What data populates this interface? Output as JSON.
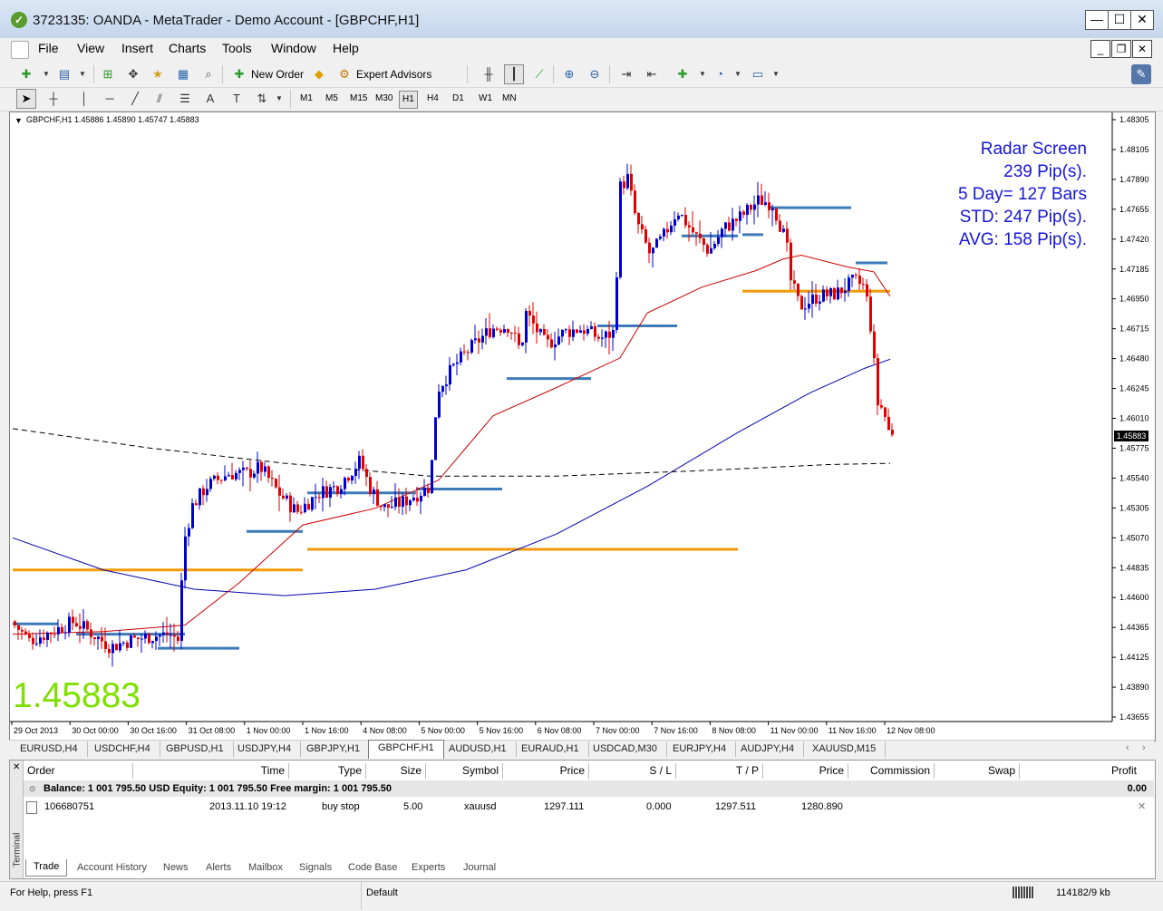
{
  "window": {
    "title": "3723135: OANDA - MetaTrader - Demo Account - [GBPCHF,H1]"
  },
  "menu": [
    "File",
    "View",
    "Insert",
    "Charts",
    "Tools",
    "Window",
    "Help"
  ],
  "toolbar": {
    "new_order": "New Order",
    "expert_advisors": "Expert Advisors",
    "timeframes": [
      "M1",
      "M5",
      "M15",
      "M30",
      "H1",
      "H4",
      "D1",
      "W1",
      "MN"
    ],
    "active_timeframe": "H1"
  },
  "chart": {
    "header": "GBPCHF,H1  1.45886 1.45890 1.45747 1.45883",
    "radar": [
      "Radar Screen",
      "239 Pip(s).",
      "5 Day= 127 Bars",
      "STD: 247 Pip(s).",
      "AVG: 158 Pip(s)."
    ],
    "big_price": "1.45883",
    "price_tag": "1.45883",
    "y_ticks": [
      "1.48305",
      "1.48105",
      "1.47890",
      "1.47655",
      "1.47420",
      "1.47185",
      "1.46950",
      "1.46715",
      "1.46480",
      "1.46245",
      "1.46010",
      "1.45775",
      "1.45540",
      "1.45305",
      "1.45070",
      "1.44835",
      "1.44600",
      "1.44365",
      "1.44125",
      "1.43890",
      "1.43655"
    ],
    "x_ticks": [
      "29 Oct 2013",
      "30 Oct 00:00",
      "30 Oct 16:00",
      "31 Oct 08:00",
      "1 Nov 00:00",
      "1 Nov 16:00",
      "4 Nov 08:00",
      "5 Nov 00:00",
      "5 Nov 16:00",
      "6 Nov 08:00",
      "7 Nov 00:00",
      "7 Nov 16:00",
      "8 Nov 08:00",
      "11 Nov 00:00",
      "11 Nov 16:00",
      "12 Nov 08:00"
    ],
    "colors": {
      "bull": "#0000cc",
      "bear": "#e00000",
      "ma_fast": "#cc0000",
      "ma_slow": "#0000aa",
      "level_blue": "#3d7ab8",
      "level_orange": "#f39a0b",
      "radar_text": "#1515d8",
      "big_price": "#7fe000"
    }
  },
  "chart_data": {
    "type": "candlestick",
    "ylim": [
      1.43655,
      1.48305
    ],
    "anchors": [
      {
        "x": 0,
        "y": 1.444
      },
      {
        "x": 20,
        "y": 1.4425
      },
      {
        "x": 45,
        "y": 1.4432
      },
      {
        "x": 70,
        "y": 1.444
      },
      {
        "x": 90,
        "y": 1.443
      },
      {
        "x": 110,
        "y": 1.442
      },
      {
        "x": 130,
        "y": 1.4425
      },
      {
        "x": 150,
        "y": 1.4428
      },
      {
        "x": 175,
        "y": 1.443
      },
      {
        "x": 185,
        "y": 1.4425
      },
      {
        "x": 190,
        "y": 1.45
      },
      {
        "x": 200,
        "y": 1.453
      },
      {
        "x": 215,
        "y": 1.4545
      },
      {
        "x": 240,
        "y": 1.4555
      },
      {
        "x": 260,
        "y": 1.4555
      },
      {
        "x": 275,
        "y": 1.456
      },
      {
        "x": 295,
        "y": 1.454
      },
      {
        "x": 315,
        "y": 1.4525
      },
      {
        "x": 340,
        "y": 1.454
      },
      {
        "x": 360,
        "y": 1.4545
      },
      {
        "x": 385,
        "y": 1.4565
      },
      {
        "x": 395,
        "y": 1.4545
      },
      {
        "x": 410,
        "y": 1.4528
      },
      {
        "x": 430,
        "y": 1.4532
      },
      {
        "x": 450,
        "y": 1.454
      },
      {
        "x": 462,
        "y": 1.4545
      },
      {
        "x": 470,
        "y": 1.462
      },
      {
        "x": 490,
        "y": 1.464
      },
      {
        "x": 510,
        "y": 1.4655
      },
      {
        "x": 530,
        "y": 1.4668
      },
      {
        "x": 550,
        "y": 1.467
      },
      {
        "x": 562,
        "y": 1.465
      },
      {
        "x": 568,
        "y": 1.468
      },
      {
        "x": 590,
        "y": 1.4655
      },
      {
        "x": 610,
        "y": 1.4665
      },
      {
        "x": 630,
        "y": 1.4668
      },
      {
        "x": 650,
        "y": 1.466
      },
      {
        "x": 665,
        "y": 1.4665
      },
      {
        "x": 672,
        "y": 1.4778
      },
      {
        "x": 680,
        "y": 1.4785
      },
      {
        "x": 690,
        "y": 1.475
      },
      {
        "x": 705,
        "y": 1.4725
      },
      {
        "x": 720,
        "y": 1.474
      },
      {
        "x": 735,
        "y": 1.476
      },
      {
        "x": 755,
        "y": 1.474
      },
      {
        "x": 770,
        "y": 1.4728
      },
      {
        "x": 785,
        "y": 1.4745
      },
      {
        "x": 805,
        "y": 1.4755
      },
      {
        "x": 825,
        "y": 1.4768
      },
      {
        "x": 840,
        "y": 1.4765
      },
      {
        "x": 855,
        "y": 1.4735
      },
      {
        "x": 860,
        "y": 1.4705
      },
      {
        "x": 870,
        "y": 1.4685
      },
      {
        "x": 890,
        "y": 1.4693
      },
      {
        "x": 910,
        "y": 1.4695
      },
      {
        "x": 930,
        "y": 1.4705
      },
      {
        "x": 942,
        "y": 1.47
      },
      {
        "x": 950,
        "y": 1.466
      },
      {
        "x": 955,
        "y": 1.461
      },
      {
        "x": 962,
        "y": 1.4605
      },
      {
        "x": 968,
        "y": 1.4588
      }
    ],
    "ma_fast": [
      [
        0,
        1.443
      ],
      [
        100,
        1.4432
      ],
      [
        190,
        1.4437
      ],
      [
        250,
        1.447
      ],
      [
        320,
        1.4515
      ],
      [
        400,
        1.4528
      ],
      [
        470,
        1.455
      ],
      [
        530,
        1.46
      ],
      [
        600,
        1.4622
      ],
      [
        670,
        1.4645
      ],
      [
        700,
        1.468
      ],
      [
        760,
        1.47
      ],
      [
        820,
        1.4713
      ],
      [
        850,
        1.4722
      ],
      [
        870,
        1.4725
      ],
      [
        920,
        1.4716
      ],
      [
        950,
        1.4712
      ],
      [
        968,
        1.4693
      ]
    ],
    "ma_slow": [
      [
        0,
        1.4505
      ],
      [
        100,
        1.448
      ],
      [
        200,
        1.4465
      ],
      [
        300,
        1.446
      ],
      [
        400,
        1.4465
      ],
      [
        500,
        1.448
      ],
      [
        600,
        1.4508
      ],
      [
        700,
        1.4545
      ],
      [
        800,
        1.4587
      ],
      [
        880,
        1.4618
      ],
      [
        940,
        1.4637
      ],
      [
        968,
        1.4644
      ]
    ],
    "ma_dashed": [
      [
        0,
        1.459
      ],
      [
        150,
        1.4575
      ],
      [
        300,
        1.4563
      ],
      [
        460,
        1.4553
      ],
      [
        600,
        1.4553
      ],
      [
        750,
        1.4557
      ],
      [
        900,
        1.4562
      ],
      [
        968,
        1.4563
      ]
    ],
    "levels": [
      {
        "color": "blue",
        "x1": 0,
        "x2": 50,
        "y": 1.4438
      },
      {
        "color": "blue",
        "x1": 70,
        "x2": 190,
        "y": 1.443
      },
      {
        "color": "blue",
        "x1": 160,
        "x2": 250,
        "y": 1.4419
      },
      {
        "color": "blue",
        "x1": 258,
        "x2": 320,
        "y": 1.451
      },
      {
        "color": "blue",
        "x1": 325,
        "x2": 445,
        "y": 1.454
      },
      {
        "color": "blue",
        "x1": 445,
        "x2": 540,
        "y": 1.4543
      },
      {
        "color": "blue",
        "x1": 545,
        "x2": 638,
        "y": 1.4629
      },
      {
        "color": "blue",
        "x1": 645,
        "x2": 733,
        "y": 1.467
      },
      {
        "color": "blue",
        "x1": 738,
        "x2": 800,
        "y": 1.474
      },
      {
        "color": "blue",
        "x1": 805,
        "x2": 828,
        "y": 1.4741
      },
      {
        "color": "blue",
        "x1": 835,
        "x2": 925,
        "y": 1.4762
      },
      {
        "color": "blue",
        "x1": 930,
        "x2": 965,
        "y": 1.4719
      },
      {
        "color": "orange",
        "x1": 0,
        "x2": 320,
        "y": 1.448
      },
      {
        "color": "orange",
        "x1": 325,
        "x2": 800,
        "y": 1.4496
      },
      {
        "color": "orange",
        "x1": 805,
        "x2": 968,
        "y": 1.4697
      }
    ]
  },
  "symbol_tabs": [
    "EURUSD,H4",
    "USDCHF,H4",
    "GBPUSD,H1",
    "USDJPY,H4",
    "GBPJPY,H1",
    "GBPCHF,H1",
    "AUDUSD,H1",
    "EURAUD,H1",
    "USDCAD,M30",
    "EURJPY,H4",
    "AUDJPY,H4",
    "XAUUSD,M15"
  ],
  "active_symbol_tab": "GBPCHF,H1",
  "terminal": {
    "side_label": "Terminal",
    "columns": [
      "Order",
      "Time",
      "Type",
      "Size",
      "Symbol",
      "Price",
      "S / L",
      "T / P",
      "Price",
      "Commission",
      "Swap",
      "Profit"
    ],
    "balance": "Balance: 1 001 795.50 USD  Equity: 1 001 795.50  Free margin: 1 001 795.50",
    "balance_profit": "0.00",
    "row": {
      "order": "106680751",
      "time": "2013.11.10 19:12",
      "type": "buy stop",
      "size": "5.00",
      "symbol": "xauusd",
      "price": "1297.111",
      "sl": "0.000",
      "tp": "1297.511",
      "price2": "1280.890"
    },
    "tabs": [
      "Trade",
      "Account History",
      "News",
      "Alerts",
      "Mailbox",
      "Signals",
      "Code Base",
      "Experts",
      "Journal"
    ],
    "active_tab": "Trade"
  },
  "status": {
    "help": "For Help, press F1",
    "profile": "Default",
    "traffic": "114182/9 kb"
  }
}
